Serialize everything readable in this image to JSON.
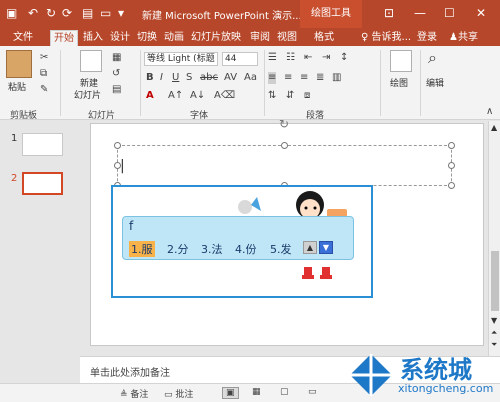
{
  "titlebar": {
    "title": "新建 Microsoft PowerPoint 演示...",
    "context_tab": "绘图工具",
    "undo_icon": "undo-icon",
    "redo_icon": "redo-icon",
    "save_icon": "save-icon"
  },
  "tabs": [
    "文件",
    "开始",
    "插入",
    "设计",
    "切换",
    "动画",
    "幻灯片放映",
    "审阅",
    "视图",
    "格式"
  ],
  "active_tab": "开始",
  "tell_me": "告诉我...",
  "login": "登录",
  "share": "共享",
  "ribbon": {
    "clipboard": {
      "paste": "粘贴",
      "label": "剪贴板"
    },
    "slides": {
      "new_slide_1": "新建",
      "new_slide_2": "幻灯片",
      "label": "幻灯片"
    },
    "font": {
      "font_name": "等线 Light (标题",
      "font_size": "44",
      "label": "字体"
    },
    "paragraph": {
      "label": "段落"
    },
    "drawing": {
      "label": "绘图"
    },
    "editing": {
      "label": "编辑"
    }
  },
  "thumbnails": [
    {
      "num": "1"
    },
    {
      "num": "2"
    }
  ],
  "ime": {
    "input": "f",
    "candidates": [
      "1.服",
      "2.分",
      "3.法",
      "4.份",
      "5.发"
    ]
  },
  "notes_placeholder": "单击此处添加备注",
  "status": {
    "notes": "备注",
    "comments": "批注"
  },
  "watermark": {
    "text": "系统城",
    "url": "xitongcheng.com"
  },
  "colors": {
    "title_bar": "#b7472a",
    "accent": "#d24726",
    "ime_border": "#2a8fd4"
  }
}
